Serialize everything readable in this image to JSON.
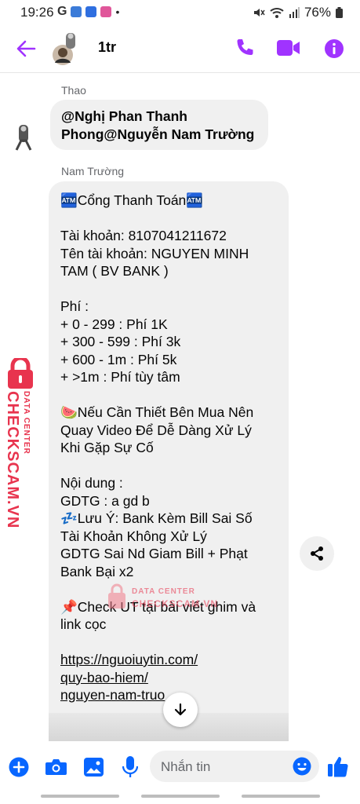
{
  "status": {
    "time": "19:26",
    "battery": "76%"
  },
  "header": {
    "title": "1tr"
  },
  "messages": [
    {
      "sender": "Thao",
      "lines": [
        "@Nghị Phan Thanh",
        "Phong@Nguyễn Nam Trường"
      ]
    },
    {
      "sender": "Nam Trường",
      "lines": [
        "🏧Cổng Thanh Toán🏧",
        "",
        "Tài khoản: 8107041211672",
        "Tên tài khoản: NGUYEN MINH",
        "TAM ( BV BANK )",
        "",
        "Phí :",
        "+ 0 - 299 : Phí 1K",
        "+ 300 - 599 : Phí 3k",
        "+ 600 - 1m : Phí 5k",
        "+ >1m : Phí tùy tâm",
        "",
        "🍉Nếu Cần Thiết Bên Mua Nên",
        "Quay Video Để Dễ Dàng Xử Lý",
        "Khi Gặp Sự Cố",
        "",
        "Nội dung :",
        "GDTG : a gd b",
        "💤Lưu Ý: Bank Kèm Bill Sai Số",
        "Tài Khoản Không Xử Lý",
        "GDTG Sai Nd Giam Bill + Phạt",
        "Bank Bại x2",
        "",
        "📌Check UT tại bài viết ghim và",
        "link cọc",
        ""
      ],
      "link_lines": [
        "https://nguoiuytin.com/",
        "quy-bao-hiem/",
        "nguyen-nam-truo"
      ]
    }
  ],
  "watermark": {
    "brand": "CHECKSCAM.VN",
    "tag": "DATA CENTER"
  },
  "composer": {
    "placeholder": "Nhắn tin"
  },
  "colors": {
    "accent": "#a033ff",
    "facebook_blue": "#0866ff",
    "watermark": "#e8344e"
  },
  "icons": [
    "back-arrow-icon",
    "phone-icon",
    "video-icon",
    "info-icon",
    "share-icon",
    "arrow-down-icon",
    "plus-icon",
    "camera-icon",
    "gallery-icon",
    "mic-icon",
    "emoji-icon",
    "thumbs-up-icon"
  ]
}
